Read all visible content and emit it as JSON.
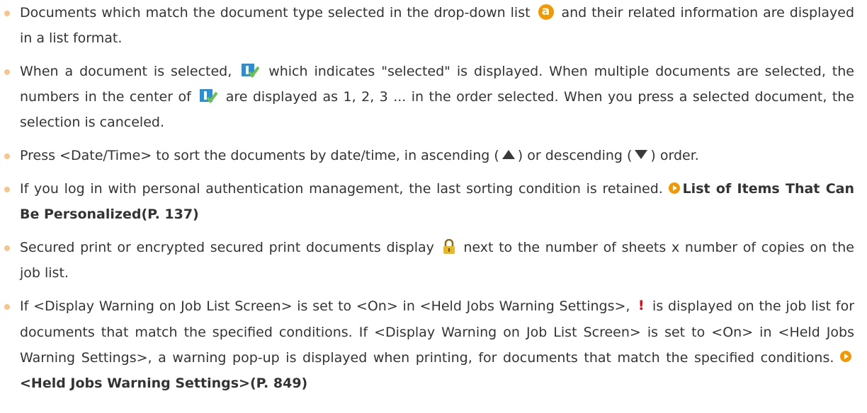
{
  "items": [
    {
      "t1": "Documents which match the document type selected in the drop-down list",
      "icon_a": "a",
      "t2": "and their related information are displayed in a list format."
    },
    {
      "t1": "When a document is selected,",
      "t2": "which indicates \"selected\" is displayed. When multiple documents are selected, the numbers in the center of",
      "t3": "are displayed as 1, 2, 3 ... in the order selected. When you press a selected document, the selection is canceled."
    },
    {
      "t1": "Press <Date/Time> to sort the documents by date/time, in ascending (",
      "t2": ") or descending (",
      "t3": ") order."
    },
    {
      "t1": "If you log in with personal authentication management, the last sorting condition is retained.",
      "link": "List of Items That Can Be Personalized(P. 137)"
    },
    {
      "t1": "Secured print or encrypted secured print documents display",
      "t2": "next to the number of sheets x number of copies on the job list."
    },
    {
      "t1": "If <Display Warning on Job List Screen> is set to <On> in <Held Jobs Warning Settings>,",
      "warn": "!",
      "t2": "is displayed on the job list for documents that match the specified conditions. If <Display Warning on Job List Screen> is set to <On> in <Held Jobs Warning Settings>, a warning pop-up is displayed when printing, for documents that match the specified conditions.",
      "link": "<Held Jobs Warning Settings>(P. 849)"
    }
  ],
  "icons": {
    "bullet_color": "#f7c58a",
    "accent": "#f39800",
    "selected_icon": "selected-check-icon",
    "lock_icon": "lock-icon",
    "warn_color": "#e60012"
  }
}
